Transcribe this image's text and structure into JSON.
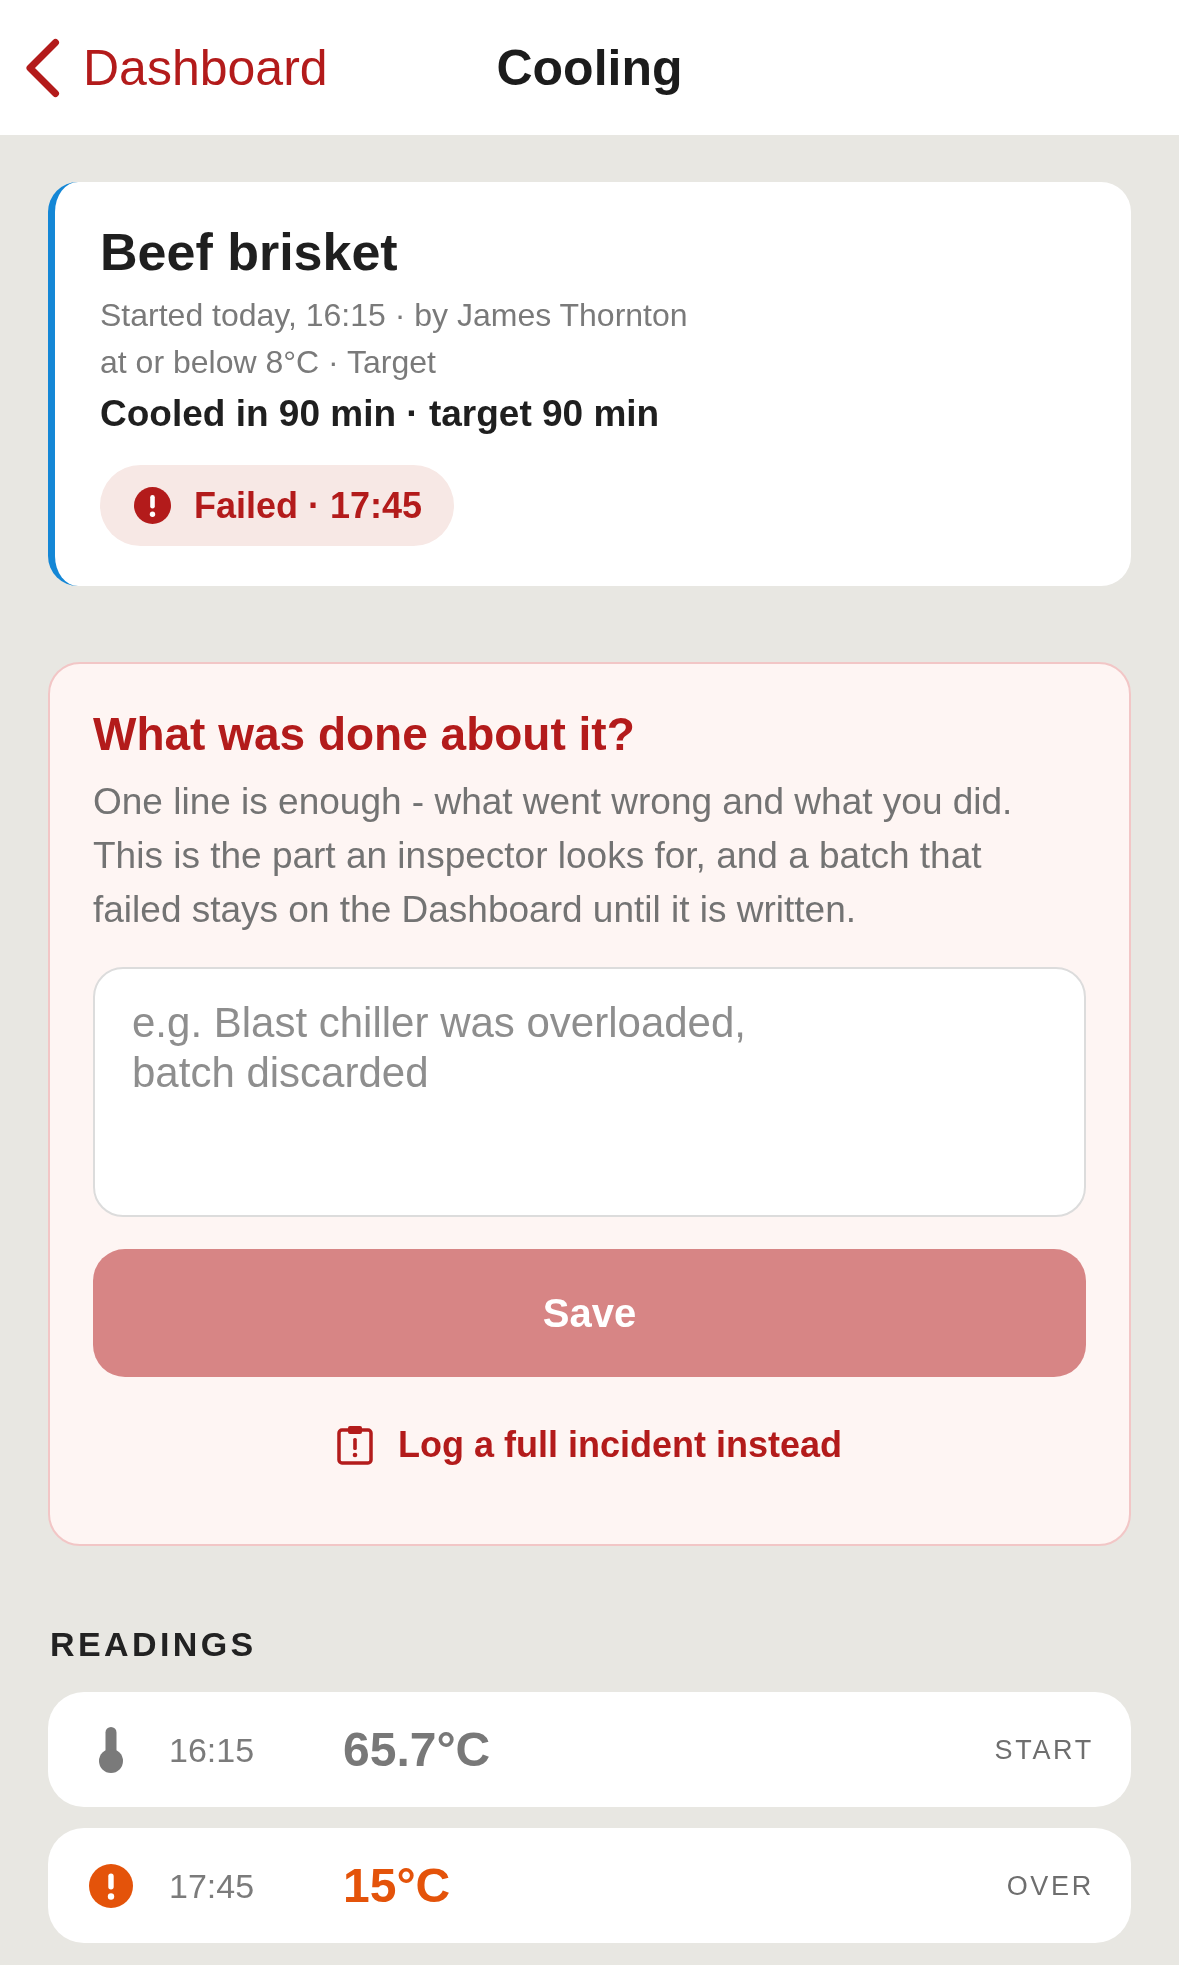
{
  "nav_bar": {
    "back_button": "Dashboard",
    "title": "Cooling"
  },
  "batch": {
    "name": "Beef brisket",
    "started": "Started today, 16:15 · by James Thornton",
    "target": "at or below 8°C · Target",
    "summary": "Cooled in 90 min · target 90 min",
    "status": {
      "kind": "failed",
      "label": "Failed · 17:45"
    }
  },
  "corrective_action": {
    "heading": "What was done about it?",
    "description": "One line is enough - what went wrong and what you did. This is the part an inspector looks for, and a batch that failed stays on the Dashboard until it is written.",
    "note_field": {
      "placeholder": "e.g. Blast chiller was overloaded,\nbatch discarded"
    },
    "save_button": {
      "label": "Save",
      "disabled": true
    },
    "incident_link": "Log a full incident instead"
  },
  "readings": {
    "heading": "READINGS",
    "rows": [
      {
        "kind": "start",
        "time": "16:15",
        "temperature": "65.7°C",
        "tag": "START"
      },
      {
        "kind": "over",
        "time": "17:45",
        "temperature": "15°C",
        "tag": "OVER"
      }
    ]
  }
}
